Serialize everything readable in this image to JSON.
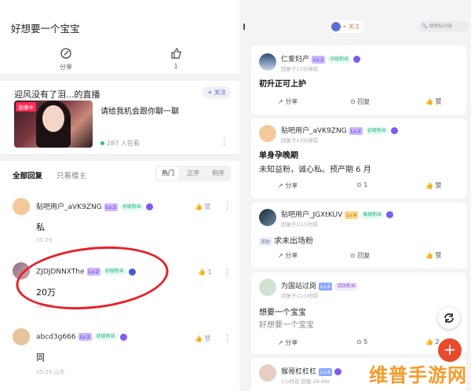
{
  "left": {
    "title": "好想要一个宝宝",
    "stats": [
      {
        "label": "分享",
        "icon": "share-edit-icon"
      },
      {
        "label": "1",
        "icon": "thumb-up-icon"
      }
    ],
    "live": {
      "title": "迎风没有了泪...的直播",
      "follow": "+ 关注",
      "badge": "直播中",
      "desc": "请给我机会跟你聊一聊",
      "viewers": "287 人在看"
    },
    "filters": {
      "all": "全部回复",
      "op_only": "只看楼主"
    },
    "sort": [
      "热门",
      "正序",
      "倒序"
    ],
    "comments": [
      {
        "user": "贴吧用户_aVK9ZNG",
        "level": "Lv.2",
        "badge": "初级粉丝",
        "text": "私",
        "meta": "05-29",
        "like": "赞"
      },
      {
        "user": "ZJDJDNNXThe",
        "level": "Lv.2",
        "badge": "初级粉丝",
        "text": "20万",
        "meta": "05-29",
        "like": "1"
      },
      {
        "user": "abcd3g666",
        "level": "Lv.2",
        "badge": "初级粉丝",
        "text": "同",
        "meta": "05-29 山东",
        "like": "赞"
      }
    ]
  },
  "right": {
    "top_pill": "+ 关注",
    "search_placeholder": "搜索贴内容",
    "cards": [
      {
        "user": "仁爱妇产",
        "level": "Lv.2",
        "badge": "中级粉丝",
        "time": "回复于13分钟前",
        "title": "初升正可上护",
        "body": "",
        "share": "分享",
        "reply": "回复",
        "like": "赞"
      },
      {
        "user": "贴吧用户_aVK9ZNG",
        "level": "Lv.2",
        "badge": "初级粉丝",
        "time": "回复于13分钟前",
        "title": "单身孕晚期",
        "body": "未知益粉，诚心私。预产期 6 月",
        "share": "分享",
        "reply": "1",
        "like": "赞"
      },
      {
        "user": "贴吧用户_JGXtKUV",
        "level": "Lv.4",
        "badge": "高级粉丝",
        "time": "回复于11小时前",
        "tag": "求助",
        "title": "",
        "body": "求未出场粉",
        "share": "分享",
        "reply": "回复",
        "like": "赞"
      },
      {
        "user": "为国站过岗",
        "level": "Lv.6",
        "badge": "活跃粉丝",
        "time": "回复于11小时前",
        "title": "",
        "body": "想要一个宝宝",
        "sub": "好想要一个宝宝",
        "share": "分享",
        "reply": "5",
        "like": "2"
      },
      {
        "user": "猴哥杠杠杠",
        "level": "Lv.8",
        "badge": "",
        "time": "2小时前 回复 24.8W",
        "title": "",
        "body": "",
        "share": "",
        "reply": "",
        "like": ""
      }
    ]
  },
  "watermark": "维普手游网",
  "colors": {
    "accent": "#4a5cd6",
    "red": "#e8212a",
    "fab": "#e84a2c",
    "level": "#c9b6ff",
    "fan": "#1fb386"
  }
}
